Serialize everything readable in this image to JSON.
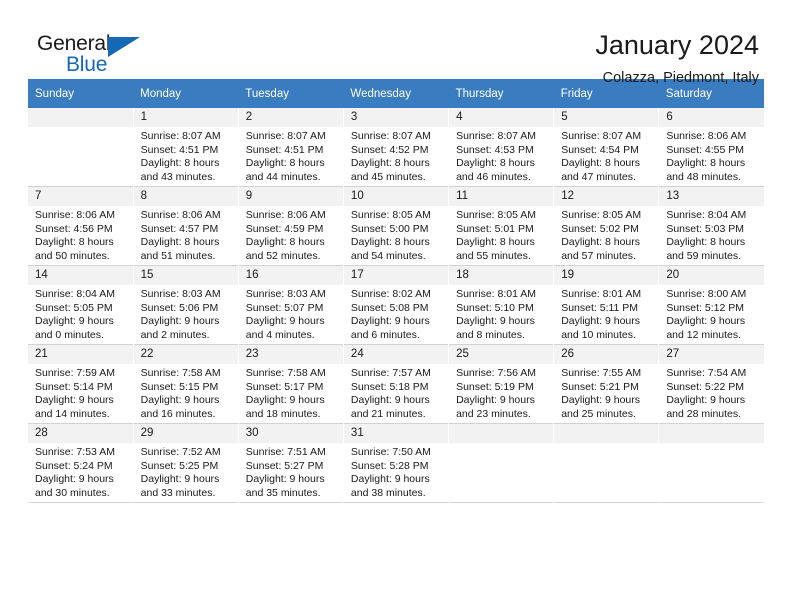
{
  "brand": {
    "name_part1": "General",
    "name_part2": "Blue",
    "accent_color": "#1569b4",
    "logo_icon": "triangle-icon"
  },
  "header": {
    "title": "January 2024",
    "subtitle": "Colazza, Piedmont, Italy"
  },
  "calendar": {
    "header_bg": "#3a7cc0",
    "daynum_bg": "#f2f2f2",
    "weekdays": [
      "Sunday",
      "Monday",
      "Tuesday",
      "Wednesday",
      "Thursday",
      "Friday",
      "Saturday"
    ],
    "weeks": [
      [
        {
          "blank": true
        },
        {
          "day": "1",
          "sunrise": "Sunrise: 8:07 AM",
          "sunset": "Sunset: 4:51 PM",
          "daylight1": "Daylight: 8 hours",
          "daylight2": "and 43 minutes."
        },
        {
          "day": "2",
          "sunrise": "Sunrise: 8:07 AM",
          "sunset": "Sunset: 4:51 PM",
          "daylight1": "Daylight: 8 hours",
          "daylight2": "and 44 minutes."
        },
        {
          "day": "3",
          "sunrise": "Sunrise: 8:07 AM",
          "sunset": "Sunset: 4:52 PM",
          "daylight1": "Daylight: 8 hours",
          "daylight2": "and 45 minutes."
        },
        {
          "day": "4",
          "sunrise": "Sunrise: 8:07 AM",
          "sunset": "Sunset: 4:53 PM",
          "daylight1": "Daylight: 8 hours",
          "daylight2": "and 46 minutes."
        },
        {
          "day": "5",
          "sunrise": "Sunrise: 8:07 AM",
          "sunset": "Sunset: 4:54 PM",
          "daylight1": "Daylight: 8 hours",
          "daylight2": "and 47 minutes."
        },
        {
          "day": "6",
          "sunrise": "Sunrise: 8:06 AM",
          "sunset": "Sunset: 4:55 PM",
          "daylight1": "Daylight: 8 hours",
          "daylight2": "and 48 minutes."
        }
      ],
      [
        {
          "day": "7",
          "sunrise": "Sunrise: 8:06 AM",
          "sunset": "Sunset: 4:56 PM",
          "daylight1": "Daylight: 8 hours",
          "daylight2": "and 50 minutes."
        },
        {
          "day": "8",
          "sunrise": "Sunrise: 8:06 AM",
          "sunset": "Sunset: 4:57 PM",
          "daylight1": "Daylight: 8 hours",
          "daylight2": "and 51 minutes."
        },
        {
          "day": "9",
          "sunrise": "Sunrise: 8:06 AM",
          "sunset": "Sunset: 4:59 PM",
          "daylight1": "Daylight: 8 hours",
          "daylight2": "and 52 minutes."
        },
        {
          "day": "10",
          "sunrise": "Sunrise: 8:05 AM",
          "sunset": "Sunset: 5:00 PM",
          "daylight1": "Daylight: 8 hours",
          "daylight2": "and 54 minutes."
        },
        {
          "day": "11",
          "sunrise": "Sunrise: 8:05 AM",
          "sunset": "Sunset: 5:01 PM",
          "daylight1": "Daylight: 8 hours",
          "daylight2": "and 55 minutes."
        },
        {
          "day": "12",
          "sunrise": "Sunrise: 8:05 AM",
          "sunset": "Sunset: 5:02 PM",
          "daylight1": "Daylight: 8 hours",
          "daylight2": "and 57 minutes."
        },
        {
          "day": "13",
          "sunrise": "Sunrise: 8:04 AM",
          "sunset": "Sunset: 5:03 PM",
          "daylight1": "Daylight: 8 hours",
          "daylight2": "and 59 minutes."
        }
      ],
      [
        {
          "day": "14",
          "sunrise": "Sunrise: 8:04 AM",
          "sunset": "Sunset: 5:05 PM",
          "daylight1": "Daylight: 9 hours",
          "daylight2": "and 0 minutes."
        },
        {
          "day": "15",
          "sunrise": "Sunrise: 8:03 AM",
          "sunset": "Sunset: 5:06 PM",
          "daylight1": "Daylight: 9 hours",
          "daylight2": "and 2 minutes."
        },
        {
          "day": "16",
          "sunrise": "Sunrise: 8:03 AM",
          "sunset": "Sunset: 5:07 PM",
          "daylight1": "Daylight: 9 hours",
          "daylight2": "and 4 minutes."
        },
        {
          "day": "17",
          "sunrise": "Sunrise: 8:02 AM",
          "sunset": "Sunset: 5:08 PM",
          "daylight1": "Daylight: 9 hours",
          "daylight2": "and 6 minutes."
        },
        {
          "day": "18",
          "sunrise": "Sunrise: 8:01 AM",
          "sunset": "Sunset: 5:10 PM",
          "daylight1": "Daylight: 9 hours",
          "daylight2": "and 8 minutes."
        },
        {
          "day": "19",
          "sunrise": "Sunrise: 8:01 AM",
          "sunset": "Sunset: 5:11 PM",
          "daylight1": "Daylight: 9 hours",
          "daylight2": "and 10 minutes."
        },
        {
          "day": "20",
          "sunrise": "Sunrise: 8:00 AM",
          "sunset": "Sunset: 5:12 PM",
          "daylight1": "Daylight: 9 hours",
          "daylight2": "and 12 minutes."
        }
      ],
      [
        {
          "day": "21",
          "sunrise": "Sunrise: 7:59 AM",
          "sunset": "Sunset: 5:14 PM",
          "daylight1": "Daylight: 9 hours",
          "daylight2": "and 14 minutes."
        },
        {
          "day": "22",
          "sunrise": "Sunrise: 7:58 AM",
          "sunset": "Sunset: 5:15 PM",
          "daylight1": "Daylight: 9 hours",
          "daylight2": "and 16 minutes."
        },
        {
          "day": "23",
          "sunrise": "Sunrise: 7:58 AM",
          "sunset": "Sunset: 5:17 PM",
          "daylight1": "Daylight: 9 hours",
          "daylight2": "and 18 minutes."
        },
        {
          "day": "24",
          "sunrise": "Sunrise: 7:57 AM",
          "sunset": "Sunset: 5:18 PM",
          "daylight1": "Daylight: 9 hours",
          "daylight2": "and 21 minutes."
        },
        {
          "day": "25",
          "sunrise": "Sunrise: 7:56 AM",
          "sunset": "Sunset: 5:19 PM",
          "daylight1": "Daylight: 9 hours",
          "daylight2": "and 23 minutes."
        },
        {
          "day": "26",
          "sunrise": "Sunrise: 7:55 AM",
          "sunset": "Sunset: 5:21 PM",
          "daylight1": "Daylight: 9 hours",
          "daylight2": "and 25 minutes."
        },
        {
          "day": "27",
          "sunrise": "Sunrise: 7:54 AM",
          "sunset": "Sunset: 5:22 PM",
          "daylight1": "Daylight: 9 hours",
          "daylight2": "and 28 minutes."
        }
      ],
      [
        {
          "day": "28",
          "sunrise": "Sunrise: 7:53 AM",
          "sunset": "Sunset: 5:24 PM",
          "daylight1": "Daylight: 9 hours",
          "daylight2": "and 30 minutes."
        },
        {
          "day": "29",
          "sunrise": "Sunrise: 7:52 AM",
          "sunset": "Sunset: 5:25 PM",
          "daylight1": "Daylight: 9 hours",
          "daylight2": "and 33 minutes."
        },
        {
          "day": "30",
          "sunrise": "Sunrise: 7:51 AM",
          "sunset": "Sunset: 5:27 PM",
          "daylight1": "Daylight: 9 hours",
          "daylight2": "and 35 minutes."
        },
        {
          "day": "31",
          "sunrise": "Sunrise: 7:50 AM",
          "sunset": "Sunset: 5:28 PM",
          "daylight1": "Daylight: 9 hours",
          "daylight2": "and 38 minutes."
        },
        {
          "blank": true
        },
        {
          "blank": true
        },
        {
          "blank": true
        }
      ]
    ]
  }
}
